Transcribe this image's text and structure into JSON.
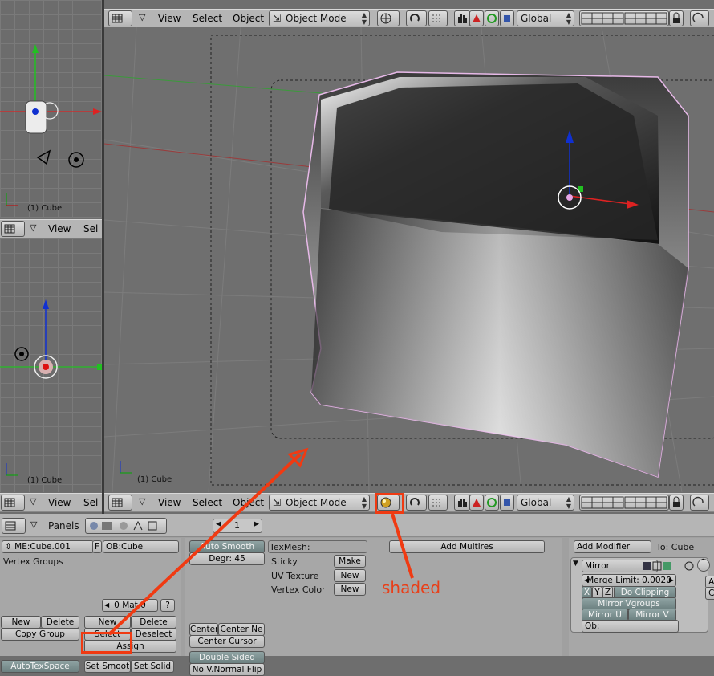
{
  "viewport_top": {
    "menus": [
      "View",
      "Select",
      "Object"
    ],
    "mode": "Object Mode",
    "orientation": "Global",
    "object_label": "(1) Cube"
  },
  "viewport_left_top": {
    "object_label": "(1) Cube"
  },
  "viewport_left_mid": {
    "menus": [
      "View",
      "Sel"
    ],
    "object_label": "(1) Cube"
  },
  "viewport_left_bottom_header": {
    "menus": [
      "View",
      "Sel"
    ]
  },
  "viewport_bottom_header": {
    "menus": [
      "View",
      "Select",
      "Object"
    ],
    "mode": "Object Mode",
    "orientation": "Global"
  },
  "buttons_window": {
    "panels_label": "Panels",
    "frame": "1",
    "link": {
      "mesh_name": "ME:Cube.001",
      "f_label": "F",
      "object_name": "OB:Cube",
      "vertex_groups": "Vertex Groups",
      "mat_label": "0 Mat 0",
      "question": "?",
      "new1": "New",
      "delete1": "Delete",
      "copy_group": "Copy Group",
      "new2": "New",
      "delete2": "Delete",
      "select": "Select",
      "deselect": "Deselect",
      "assign": "Assign",
      "autotexspace": "AutoTexSpace",
      "set_smooth": "Set Smoot",
      "set_solid": "Set Solid"
    },
    "mesh": {
      "auto_smooth": "Auto Smooth",
      "degr": "Degr: 45",
      "center": "Center",
      "center_new": "Center Ne",
      "center_cursor": "Center Cursor",
      "double_sided": "Double Sided",
      "no_vnormal_flip": "No V.Normal Flip"
    },
    "texmesh": {
      "label": "TexMesh:",
      "sticky": "Sticky",
      "sticky_btn": "Make",
      "uv_texture": "UV Texture",
      "uv_btn": "New",
      "vertex_color": "Vertex Color",
      "vc_btn": "New"
    },
    "multires": {
      "add": "Add Multires"
    },
    "modifiers": {
      "add_modifier": "Add Modifier",
      "to": "To: Cube",
      "mirror": "Mirror",
      "merge_limit": "Merge Limit: 0.0020",
      "x": "X",
      "y": "Y",
      "z": "Z",
      "do_clipping": "Do Clipping",
      "mirror_vgroups": "Mirror Vgroups",
      "mirror_u": "Mirror U",
      "mirror_v": "Mirror V",
      "ob": "Ob:",
      "ap": "Ap",
      "co": "Co"
    }
  },
  "annotation": {
    "text": "shaded",
    "color": "#e8401a"
  }
}
